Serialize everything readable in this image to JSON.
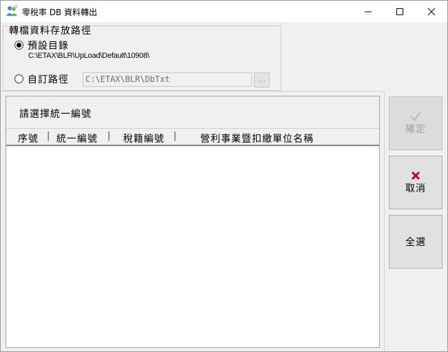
{
  "window": {
    "title": "零稅率 DB 資料轉出",
    "icon": "app-people-icon",
    "controls": [
      "minimize",
      "maximize",
      "close"
    ]
  },
  "path_group": {
    "legend": "轉檔資料存放路徑",
    "default_option": {
      "label": "預設目錄",
      "checked": true,
      "path": "C:\\ETAX\\BLR\\UpLoad\\Default\\10908\\"
    },
    "custom_option": {
      "label": "自訂路徑",
      "checked": false,
      "path_value": "C:\\ETAX\\BLR\\DbTxt",
      "browse_label": "..."
    }
  },
  "list": {
    "heading": "請選擇統一編號",
    "columns": [
      "序號",
      "統一編號",
      "稅籍編號",
      "營利事業暨扣繳單位名稱"
    ],
    "separator": "|",
    "rows": []
  },
  "buttons": {
    "confirm": {
      "label": "確定",
      "icon": "check-icon",
      "enabled": false
    },
    "cancel": {
      "label": "取消",
      "icon": "x-icon",
      "enabled": true,
      "icon_color": "#b01020"
    },
    "select_all": {
      "label": "全選",
      "enabled": true
    }
  }
}
